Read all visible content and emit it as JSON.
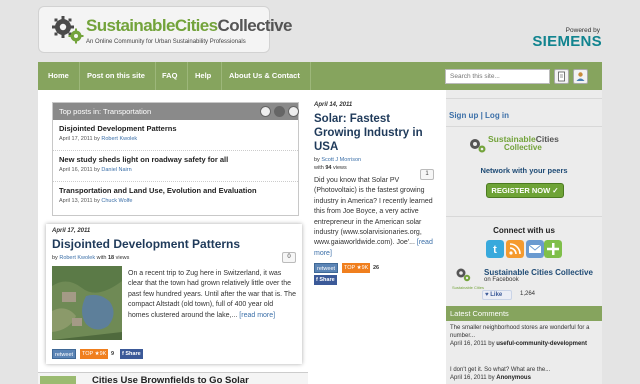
{
  "header": {
    "logo_green": "SustainableCities",
    "logo_dark": "Collective",
    "tagline": "An Online Community for Urban Sustainability Professionals",
    "powered_by": "Powered by",
    "sponsor": "SIEMENS"
  },
  "nav": {
    "items": [
      "Home",
      "Post on this site",
      "FAQ",
      "Help",
      "About Us & Contact"
    ],
    "search_placeholder": "Search this site..."
  },
  "top_posts": {
    "title": "Top posts in: Transportation",
    "items": [
      {
        "title": "Disjointed Development Patterns",
        "date": "April 17, 2011 by",
        "author": "Robert Kwolek"
      },
      {
        "title": "New study sheds light on roadway safety for all",
        "date": "April 16, 2011 by",
        "author": "Daniel Nairn"
      },
      {
        "title": "Transportation and Land Use, Evolution and Evaluation",
        "date": "April 13, 2011 by",
        "author": "Chuck Wolfe"
      }
    ]
  },
  "featured": {
    "date": "April 17, 2011",
    "title": "Disjointed Development Patterns",
    "by": "by",
    "author": "Robert Kwolek",
    "with": "with",
    "views": "18",
    "views_label": "views",
    "comments": "0",
    "body": "On a recent trip to Zug here in Switzerland, it was clear that the town had grown relatively little over the past few hundred years. Until after the war that is. The compact Altstadt (old town), full of 400 year old homes clustered around the lake,...",
    "read_more": "[read more]",
    "social": {
      "retweet": "retweet",
      "top": "TOP ★9K",
      "count": "9",
      "share": "f Share"
    }
  },
  "middle": {
    "date": "April 14, 2011",
    "title": "Solar: Fastest Growing Industry in USA",
    "by": "by",
    "author": "Scott J Morrison",
    "with": "with",
    "views": "94",
    "views_label": "views",
    "comments": "1",
    "body": "Did you know that Solar PV (Photovoltaic) is the fastest growing industry in America? I recently learned this from Joe Boyce, a very active entrepreneur in the American solar industry (www.solarvisionaries.org, www.gaiaworldwide.com). Joe'...",
    "read_more": "[read more]",
    "social": {
      "retweet": "retweet",
      "top": "TOP ★9K",
      "count": "26",
      "share": "f Share"
    }
  },
  "bottom": {
    "title": "Cities Use Brownfields to Go Solar"
  },
  "sidebar": {
    "signup": "Sign up",
    "separator": "|",
    "login": "Log in",
    "ad_logo_green": "Sustainable",
    "ad_logo_dark": "Cities",
    "ad_logo_sub": "Collective",
    "ad_network": "Network with your peers",
    "ad_button": "REGISTER NOW",
    "ad_button_arrow": "✓",
    "connect": "Connect with us",
    "fb_name": "Sustainable Cities Collective",
    "fb_on": "on Facebook",
    "fb_small": "Sustainable Cities",
    "like": "Like",
    "like_count": "1,264",
    "latest_comments": "Latest Comments",
    "comments": [
      {
        "text": "The smaller neighborhood stores are wonderful for a number...",
        "date": "April 16, 2011 by",
        "author": "useful-community-development"
      },
      {
        "text": "I don't get it.  So what?  What are the...",
        "date": "April 16, 2011 by",
        "author": "Anonymous"
      }
    ]
  },
  "colors": {
    "nav_green": "#86a45e",
    "title_blue": "#1f3a5a",
    "link_blue": "#3b6fa8",
    "brand_green": "#73a33b",
    "siemens": "#11848f"
  }
}
